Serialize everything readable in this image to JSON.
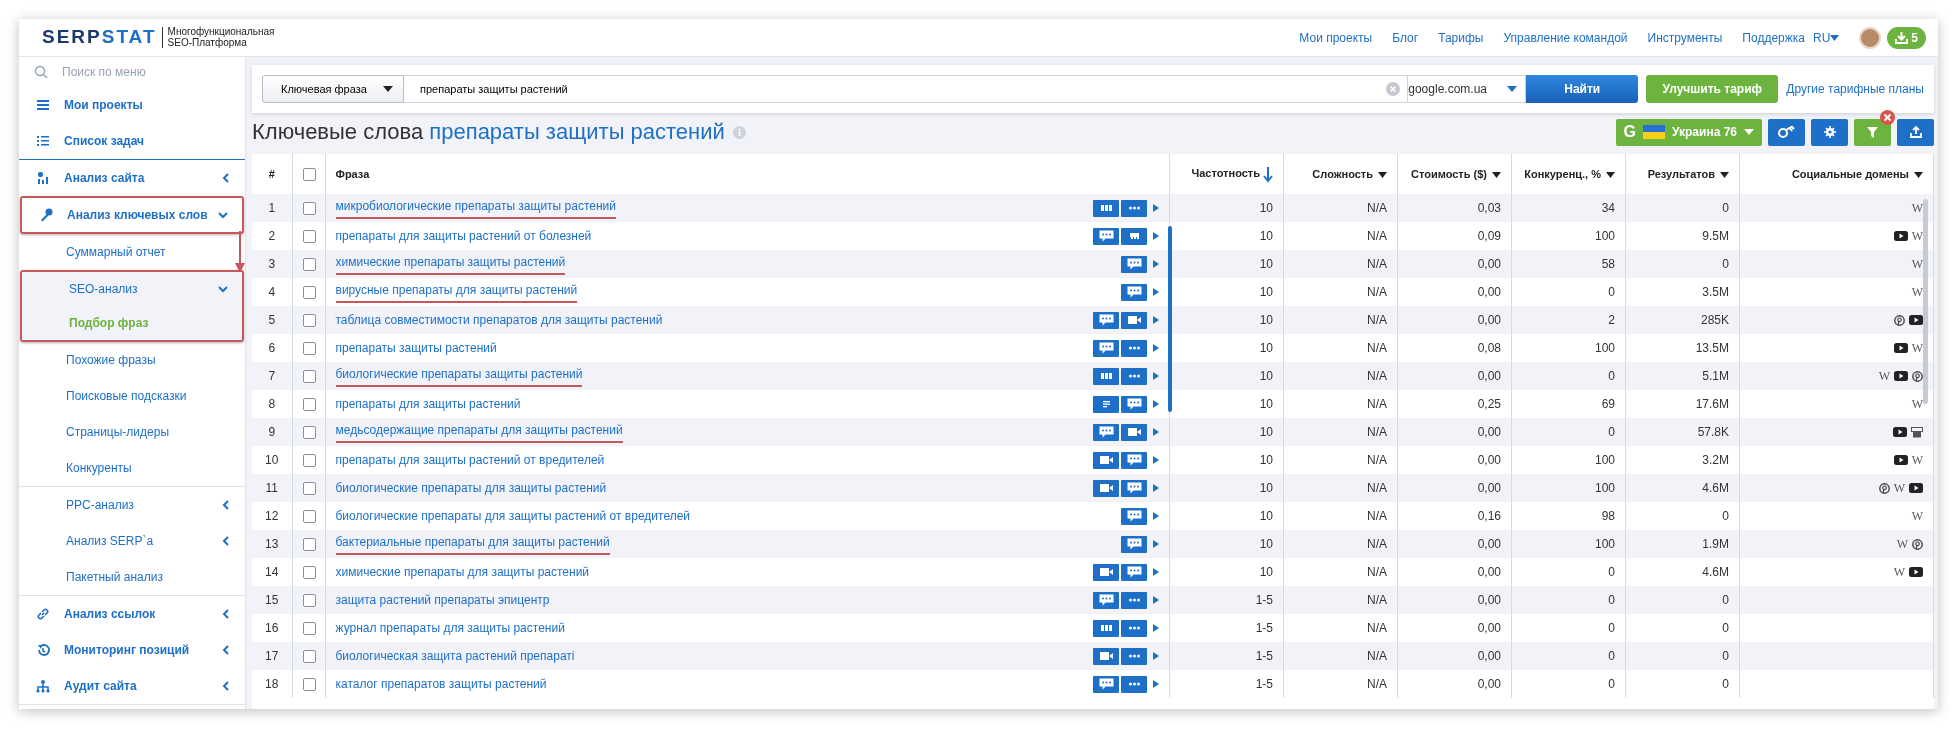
{
  "header": {
    "logo_text": [
      "SERP",
      "STAT"
    ],
    "tagline": [
      "Многофункциональная",
      "SEO-Платформа"
    ],
    "nav": [
      "Мои проекты",
      "Блог",
      "Тарифы",
      "Управление командой",
      "Инструменты",
      "Поддержка"
    ],
    "language": "RU",
    "downloads": "5"
  },
  "sidebar": {
    "search": {
      "placeholder": "Поиск по меню"
    },
    "groups": [
      {
        "items": [
          {
            "kind": "main",
            "label": "Мои проекты",
            "selected": false,
            "annotated": false
          },
          {
            "kind": "main",
            "label": "Список задач",
            "selected": false,
            "annotated": false
          }
        ]
      },
      {
        "items": [
          {
            "kind": "main",
            "label": "Анализ сайта",
            "expanded": false,
            "selected": false,
            "annotated": false
          },
          {
            "kind": "main",
            "label": "Анализ ключевых слов",
            "expanded": true,
            "selected": false,
            "annotated": true
          },
          {
            "kind": "sub",
            "label": "Суммарный отчет",
            "selected": false,
            "annotated": false
          },
          {
            "kind": "sub",
            "label": "SEO-анализ",
            "expanded": true,
            "selected": false,
            "annotated": true
          },
          {
            "kind": "sub",
            "label": "Подбор фраз",
            "selected": true,
            "annotated": true
          },
          {
            "kind": "sub",
            "label": "Похожие фразы",
            "selected": false,
            "annotated": false
          },
          {
            "kind": "sub",
            "label": "Поисковые подсказки",
            "selected": false,
            "annotated": false
          },
          {
            "kind": "sub",
            "label": "Страницы-лидеры",
            "selected": false,
            "annotated": false
          },
          {
            "kind": "sub",
            "label": "Конкуренты",
            "selected": false,
            "annotated": false
          }
        ]
      },
      {
        "items": [
          {
            "kind": "sub",
            "label": "PPC-анализ",
            "expanded": false,
            "selected": false,
            "annotated": false
          },
          {
            "kind": "sub",
            "label": "Анализ SERP`a",
            "expanded": false,
            "selected": false,
            "annotated": false
          },
          {
            "kind": "sub",
            "label": "Пакетный анализ",
            "selected": false,
            "annotated": false
          }
        ]
      },
      {
        "items": [
          {
            "kind": "main",
            "label": "Анализ ссылок",
            "expanded": false,
            "selected": false,
            "annotated": false
          },
          {
            "kind": "main",
            "label": "Мониторинг позиций",
            "expanded": false,
            "selected": false,
            "annotated": false
          },
          {
            "kind": "main",
            "label": "Аудит сайта",
            "expanded": false,
            "selected": false,
            "annotated": false
          }
        ]
      }
    ]
  },
  "search_bar": {
    "type": "Ключевая фраза",
    "query": "препараты защиты растений",
    "domain": "google.com.ua",
    "submit": "Найти",
    "upgrade": "Улучшить тариф",
    "plans_link": "Другие тарифные планы"
  },
  "title": {
    "text": "Ключевые слова",
    "query": "препараты защиты растений"
  },
  "toolbar": {
    "engine_mark": "G",
    "region": "Украина 76",
    "filter_active": true
  },
  "table": {
    "columns": [
      {
        "kind": "index",
        "label": "#"
      },
      {
        "kind": "checkbox",
        "checked": false
      },
      {
        "kind": "phrase",
        "label": "Фраза"
      },
      {
        "kind": "metric",
        "label": "Частотность",
        "sorted": true
      },
      {
        "kind": "metric",
        "label": "Сложность",
        "sorted": false
      },
      {
        "kind": "metric",
        "label": "Стоимость ($)",
        "sorted": false
      },
      {
        "kind": "metric",
        "label": "Конкуренц., %",
        "sorted": false
      },
      {
        "kind": "metric",
        "label": "Результатов",
        "sorted": false
      },
      {
        "kind": "social",
        "label": "Социальные домены",
        "sorted": false
      }
    ],
    "rows": [
      {
        "index": "1",
        "checked": false,
        "phrase": "микробиологические препараты защиты растений",
        "annotated": true,
        "features": [
          {
            "kind": "bars"
          },
          {
            "kind": "dots"
          }
        ],
        "values": [
          "10",
          "N/A",
          "0,03",
          "34",
          "0"
        ],
        "social": [
          {
            "kind": "wiki",
            "text": "W"
          }
        ]
      },
      {
        "index": "2",
        "checked": false,
        "phrase": "препараты для защиты растений от болезней",
        "annotated": false,
        "features": [
          {
            "kind": "chat"
          },
          {
            "kind": "image"
          }
        ],
        "values": [
          "10",
          "N/A",
          "0,09",
          "100",
          "9.5M"
        ],
        "social": [
          {
            "kind": "youtube"
          },
          {
            "kind": "wiki",
            "text": "W"
          }
        ]
      },
      {
        "index": "3",
        "checked": false,
        "phrase": "химические препараты защиты растений",
        "annotated": true,
        "features": [
          {
            "kind": "chat"
          }
        ],
        "values": [
          "10",
          "N/A",
          "0,00",
          "58",
          "0"
        ],
        "social": [
          {
            "kind": "wiki",
            "text": "W"
          }
        ]
      },
      {
        "index": "4",
        "checked": false,
        "phrase": "вирусные препараты для защиты растений",
        "annotated": true,
        "features": [
          {
            "kind": "chat"
          }
        ],
        "values": [
          "10",
          "N/A",
          "0,00",
          "0",
          "3.5M"
        ],
        "social": [
          {
            "kind": "wiki",
            "text": "W"
          }
        ]
      },
      {
        "index": "5",
        "checked": false,
        "phrase": "таблица совместимости препаратов для защиты растений",
        "annotated": false,
        "features": [
          {
            "kind": "chat"
          },
          {
            "kind": "video"
          }
        ],
        "values": [
          "10",
          "N/A",
          "0,00",
          "2",
          "285K"
        ],
        "social": [
          {
            "kind": "pinterest"
          },
          {
            "kind": "youtube"
          }
        ]
      },
      {
        "index": "6",
        "checked": false,
        "phrase": "препараты защиты растений",
        "annotated": false,
        "features": [
          {
            "kind": "chat"
          },
          {
            "kind": "dots"
          }
        ],
        "values": [
          "10",
          "N/A",
          "0,08",
          "100",
          "13.5M"
        ],
        "social": [
          {
            "kind": "youtube"
          },
          {
            "kind": "wiki",
            "text": "W"
          }
        ]
      },
      {
        "index": "7",
        "checked": false,
        "phrase": "биологические препараты защиты растений",
        "annotated": true,
        "features": [
          {
            "kind": "bars"
          },
          {
            "kind": "dots"
          }
        ],
        "values": [
          "10",
          "N/A",
          "0,00",
          "0",
          "5.1M"
        ],
        "social": [
          {
            "kind": "wiki",
            "text": "W"
          },
          {
            "kind": "youtube"
          },
          {
            "kind": "pinterest"
          }
        ]
      },
      {
        "index": "8",
        "checked": false,
        "phrase": "препараты для защиты растений",
        "annotated": false,
        "features": [
          {
            "kind": "list"
          },
          {
            "kind": "chat"
          }
        ],
        "values": [
          "10",
          "N/A",
          "0,25",
          "69",
          "17.6M"
        ],
        "social": [
          {
            "kind": "wiki",
            "text": "W"
          }
        ]
      },
      {
        "index": "9",
        "checked": false,
        "phrase": "медьсодержащие препараты для защиты растений",
        "annotated": true,
        "features": [
          {
            "kind": "chat"
          },
          {
            "kind": "video"
          }
        ],
        "values": [
          "10",
          "N/A",
          "0,00",
          "0",
          "57.8K"
        ],
        "social": [
          {
            "kind": "youtube"
          },
          {
            "kind": "shop"
          }
        ]
      },
      {
        "index": "10",
        "checked": false,
        "phrase": "препараты для защиты растений от вредителей",
        "annotated": false,
        "features": [
          {
            "kind": "video"
          },
          {
            "kind": "chat"
          }
        ],
        "values": [
          "10",
          "N/A",
          "0,00",
          "100",
          "3.2M"
        ],
        "social": [
          {
            "kind": "youtube"
          },
          {
            "kind": "wiki",
            "text": "W"
          }
        ]
      },
      {
        "index": "11",
        "checked": false,
        "phrase": "биологические препараты для защиты растений",
        "annotated": false,
        "features": [
          {
            "kind": "video"
          },
          {
            "kind": "chat"
          }
        ],
        "values": [
          "10",
          "N/A",
          "0,00",
          "100",
          "4.6M"
        ],
        "social": [
          {
            "kind": "pinterest"
          },
          {
            "kind": "wiki",
            "text": "W"
          },
          {
            "kind": "youtube"
          }
        ]
      },
      {
        "index": "12",
        "checked": false,
        "phrase": "биологические препараты для защиты растений от вредителей",
        "annotated": false,
        "features": [
          {
            "kind": "chat"
          }
        ],
        "values": [
          "10",
          "N/A",
          "0,16",
          "98",
          "0"
        ],
        "social": [
          {
            "kind": "wiki",
            "text": "W"
          }
        ]
      },
      {
        "index": "13",
        "checked": false,
        "phrase": "бактериальные препараты для защиты растений",
        "annotated": true,
        "features": [
          {
            "kind": "chat"
          }
        ],
        "values": [
          "10",
          "N/A",
          "0,00",
          "100",
          "1.9M"
        ],
        "social": [
          {
            "kind": "wiki",
            "text": "W"
          },
          {
            "kind": "pinterest"
          }
        ]
      },
      {
        "index": "14",
        "checked": false,
        "phrase": "химические препараты для защиты растений",
        "annotated": false,
        "features": [
          {
            "kind": "video"
          },
          {
            "kind": "chat"
          }
        ],
        "values": [
          "10",
          "N/A",
          "0,00",
          "0",
          "4.6M"
        ],
        "social": [
          {
            "kind": "wiki",
            "text": "W"
          },
          {
            "kind": "youtube"
          }
        ]
      },
      {
        "index": "15",
        "checked": false,
        "phrase": "защита растений препараты эпицентр",
        "annotated": false,
        "features": [
          {
            "kind": "chat"
          },
          {
            "kind": "dots"
          }
        ],
        "values": [
          "1-5",
          "N/A",
          "0,00",
          "0",
          "0"
        ],
        "social": []
      },
      {
        "index": "16",
        "checked": false,
        "phrase": "журнал препараты для защиты растений",
        "annotated": false,
        "features": [
          {
            "kind": "bars"
          },
          {
            "kind": "dots"
          }
        ],
        "values": [
          "1-5",
          "N/A",
          "0,00",
          "0",
          "0"
        ],
        "social": []
      },
      {
        "index": "17",
        "checked": false,
        "phrase": "биологическая защита растений препараті",
        "annotated": false,
        "features": [
          {
            "kind": "video"
          },
          {
            "kind": "dots"
          }
        ],
        "values": [
          "1-5",
          "N/A",
          "0,00",
          "0",
          "0"
        ],
        "social": []
      },
      {
        "index": "18",
        "checked": false,
        "phrase": "каталог препаратов защиты растений",
        "annotated": false,
        "features": [
          {
            "kind": "chat"
          },
          {
            "kind": "dots"
          }
        ],
        "values": [
          "1-5",
          "N/A",
          "0,00",
          "0",
          "0"
        ],
        "social": []
      }
    ]
  }
}
